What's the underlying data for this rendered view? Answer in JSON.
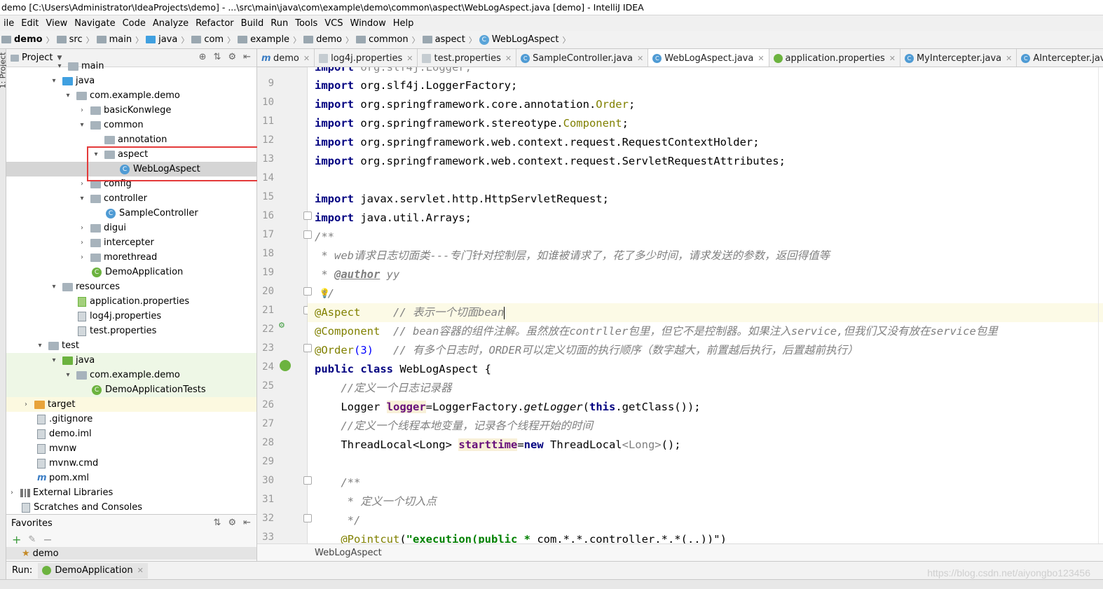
{
  "window": {
    "title": "demo [C:\\Users\\Administrator\\IdeaProjects\\demo] - ...\\src\\main\\java\\com\\example\\demo\\common\\aspect\\WebLogAspect.java [demo] - IntelliJ IDEA"
  },
  "menu": [
    "ile",
    "Edit",
    "View",
    "Navigate",
    "Code",
    "Analyze",
    "Refactor",
    "Build",
    "Run",
    "Tools",
    "VCS",
    "Window",
    "Help"
  ],
  "breadcrumb": [
    "demo",
    "src",
    "main",
    "java",
    "com",
    "example",
    "demo",
    "common",
    "aspect",
    "WebLogAspect"
  ],
  "project_panel": {
    "title": "Project",
    "side_label": "1: Project",
    "tree": [
      {
        "label": "main",
        "indent": 4
      },
      {
        "label": "java",
        "indent": 4
      },
      {
        "label": "com.example.demo",
        "indent": 5
      },
      {
        "label": "basicKonwlege",
        "indent": 6
      },
      {
        "label": "common",
        "indent": 6
      },
      {
        "label": "annotation",
        "indent": 7
      },
      {
        "label": "aspect",
        "indent": 7
      },
      {
        "label": "WebLogAspect",
        "indent": 8
      },
      {
        "label": "config",
        "indent": 6
      },
      {
        "label": "controller",
        "indent": 6
      },
      {
        "label": "SampleController",
        "indent": 7
      },
      {
        "label": "digui",
        "indent": 6
      },
      {
        "label": "intercepter",
        "indent": 6
      },
      {
        "label": "morethread",
        "indent": 6
      },
      {
        "label": "DemoApplication",
        "indent": 6
      },
      {
        "label": "resources",
        "indent": 4
      },
      {
        "label": "application.properties",
        "indent": 5
      },
      {
        "label": "log4j.properties",
        "indent": 5
      },
      {
        "label": "test.properties",
        "indent": 5
      },
      {
        "label": "test",
        "indent": 3
      },
      {
        "label": "java",
        "indent": 4
      },
      {
        "label": "com.example.demo",
        "indent": 5
      },
      {
        "label": "DemoApplicationTests",
        "indent": 6
      },
      {
        "label": "target",
        "indent": 2
      },
      {
        "label": ".gitignore",
        "indent": 2
      },
      {
        "label": "demo.iml",
        "indent": 2
      },
      {
        "label": "mvnw",
        "indent": 2
      },
      {
        "label": "mvnw.cmd",
        "indent": 2
      },
      {
        "label": "pom.xml",
        "indent": 2
      },
      {
        "label": "External Libraries",
        "indent": 1
      },
      {
        "label": "Scratches and Consoles",
        "indent": 1
      }
    ]
  },
  "favorites": {
    "title": "Favorites",
    "item": "demo"
  },
  "tabs": [
    {
      "label": "demo",
      "active": false
    },
    {
      "label": "log4j.properties",
      "active": false
    },
    {
      "label": "test.properties",
      "active": false
    },
    {
      "label": "SampleController.java",
      "active": false
    },
    {
      "label": "WebLogAspect.java",
      "active": true
    },
    {
      "label": "application.properties",
      "active": false
    },
    {
      "label": "MyIntercepter.java",
      "active": false
    },
    {
      "label": "AIntercepter.java",
      "active": false
    },
    {
      "label": "M",
      "active": false
    }
  ],
  "editor": {
    "line_numbers": [
      "9",
      "10",
      "11",
      "12",
      "13",
      "14",
      "15",
      "16",
      "17",
      "18",
      "19",
      "20",
      "21",
      "22",
      "23",
      "24",
      "25",
      "26",
      "27",
      "28",
      "29",
      "30",
      "31",
      "32",
      "33"
    ],
    "lines": {
      "l9_a": "import",
      "l9_b": " org.slf4j.LoggerFactory;",
      "l10_a": "import",
      "l10_b": " org.springframework.core.annotation.",
      "l10_c": "Order",
      "l10_d": ";",
      "l11_a": "import",
      "l11_b": " org.springframework.stereotype.",
      "l11_c": "Component",
      "l11_d": ";",
      "l12_a": "import",
      "l12_b": " org.springframework.web.context.request.RequestContextHolder;",
      "l13_a": "import",
      "l13_b": " org.springframework.web.context.request.ServletRequestAttributes;",
      "l15_a": "import",
      "l15_b": " javax.servlet.http.HttpServletRequest;",
      "l16_a": "import",
      "l16_b": " java.util.Arrays;",
      "l17": "/**",
      "l18": " * web请求日志切面类---专门针对控制层，如谁被请求了，花了多少时间，请求发送的参数，返回得值等",
      "l19_a": " * ",
      "l19_b": "@author",
      "l19_c": " yy",
      "l20": " */",
      "l21_a": "@Aspect",
      "l21_b": "     // 表示一个切面bea",
      "l21_c": "n",
      "l22_a": "@Component",
      "l22_b": "  // bean容器的组件注解。虽然放在contrller包里，但它不是控制器。如果注入service,但我们又没有放在service包里",
      "l23_a": "@Order",
      "l23_b": "(3)",
      "l23_c": "   // 有多个日志时，ORDER可以定义切面的执行顺序（数字越大，前置越后执行，后置越前执行）",
      "l24_a": "public class",
      "l24_b": " WebLogAspect {",
      "l25": "    //定义一个日志记录器",
      "l26_a": "    Logger ",
      "l26_b": "logger",
      "l26_c": "=LoggerFactory.",
      "l26_d": "getLogger",
      "l26_e": "(",
      "l26_f": "this",
      "l26_g": ".getClass());",
      "l27": "    //定义一个线程本地变量，记录各个线程开始的时间",
      "l28_a": "    ThreadLocal<Long> ",
      "l28_b": "starttime",
      "l28_c": "=",
      "l28_d": "new",
      "l28_e": " ThreadLocal",
      "l28_f": "<Long>",
      "l28_g": "();",
      "l30": "    /**",
      "l31": "     * 定义一个切入点",
      "l32": "     */",
      "l33_a": "    @Pointcut",
      "l33_b": "(",
      "l33_c": "\"execution(public * ",
      "l33_d": "com.*.*.controller.*.*(..))\"",
      "l33_e": ")"
    },
    "footer": "WebLogAspect"
  },
  "run": {
    "label": "Run:",
    "tab": "DemoApplication"
  },
  "watermark": "https://blog.csdn.net/aiyongbo123456",
  "colors": {
    "highlight_box": "#e43a3a",
    "keyword": "#000080",
    "annotation": "#808000",
    "comment": "#808080",
    "field": "#660e7a"
  }
}
